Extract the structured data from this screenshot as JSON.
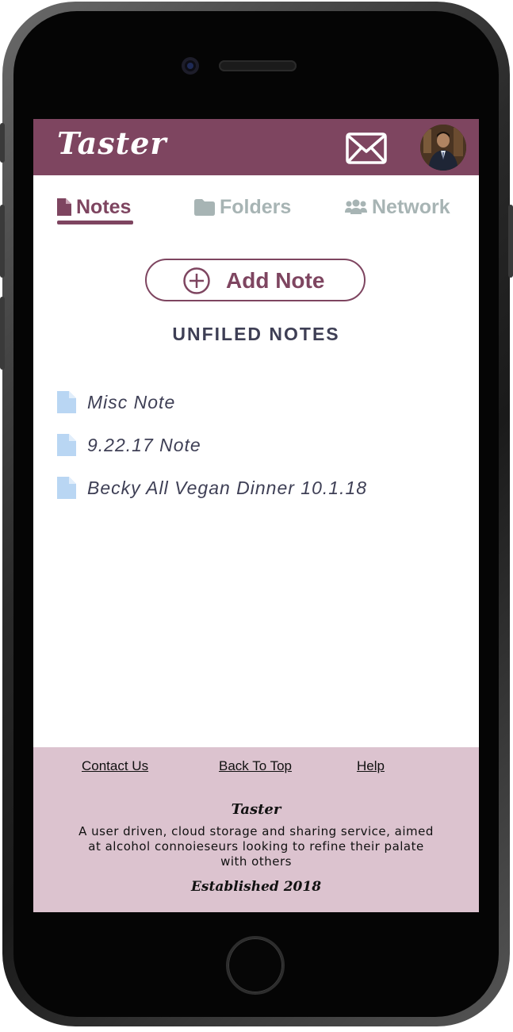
{
  "colors": {
    "brand": "#7e4560",
    "inactive_tab": "#a7b4b4",
    "footer_bg": "#dcc3cf",
    "doc_icon": "#b9d6f3",
    "text_dark": "#3e3f55"
  },
  "header": {
    "logo": "Taster",
    "mail_icon": "envelope-icon",
    "avatar": "user-avatar"
  },
  "tabs": [
    {
      "label": "Notes",
      "icon": "document-icon",
      "active": true
    },
    {
      "label": "Folders",
      "icon": "folder-icon",
      "active": false
    },
    {
      "label": "Network",
      "icon": "users-icon",
      "active": false
    }
  ],
  "add_note": {
    "label": "Add Note",
    "icon": "plus-circle-icon"
  },
  "section_title": "UNFILED NOTES",
  "notes": [
    {
      "title": "Misc Note"
    },
    {
      "title": "9.22.17 Note"
    },
    {
      "title": "Becky All Vegan Dinner 10.1.18"
    }
  ],
  "footer": {
    "links": [
      "Contact Us",
      "Back To Top",
      "Help"
    ],
    "brand": "Taster",
    "description": "A user driven, cloud storage and sharing service, aimed at alcohol connoieseurs looking to refine their palate with others",
    "established": "Established 2018"
  }
}
